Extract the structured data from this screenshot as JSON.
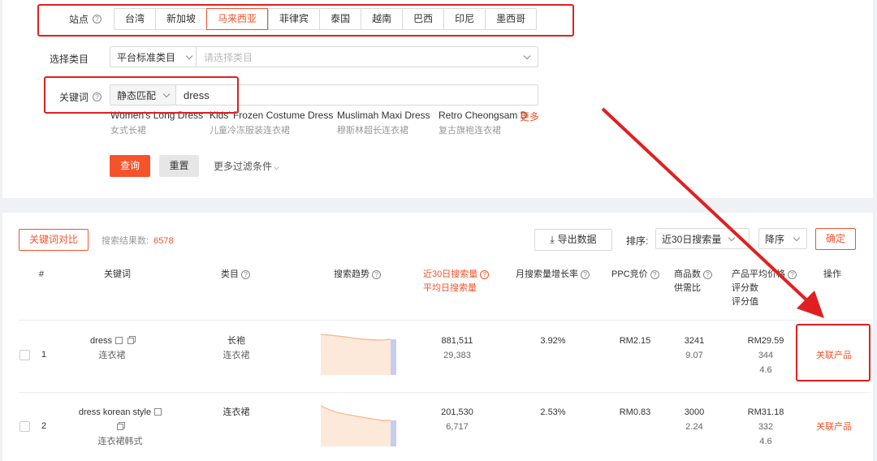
{
  "filter": {
    "site_label": "站点",
    "sites": [
      "台湾",
      "新加坡",
      "马来西亚",
      "菲律宾",
      "泰国",
      "越南",
      "巴西",
      "印尼",
      "墨西哥"
    ],
    "active_site": "马来西亚",
    "category_label": "选择类目",
    "category_type": "平台标准类目",
    "category_placeholder": "请选择类目",
    "keyword_label": "关键词",
    "match_type": "静态匹配",
    "keyword_value": "dress",
    "suggestions": [
      {
        "en": "Women's Long Dress",
        "cn": "女式长裙"
      },
      {
        "en": "Kids' Frozen Costume Dress",
        "cn": "儿童冷冻服装连衣裙"
      },
      {
        "en": "Muslimah Maxi Dress",
        "cn": "穆斯林超长连衣裙"
      },
      {
        "en": "Retro Cheongsam D",
        "cn": "复古旗袍连衣裙"
      }
    ],
    "more_suggestions": "更多",
    "query_button": "查询",
    "reset_button": "重置",
    "more_filters": "更多过滤条件"
  },
  "results": {
    "compare_button": "关键词对比",
    "result_count_label": "搜索结果数:",
    "result_count": "6578",
    "export_button": "导出数据",
    "sort_label": "排序:",
    "sort_field": "近30日搜索量",
    "sort_order": "降序",
    "confirm_button": "确定",
    "columns": {
      "index": "#",
      "keyword": "关键词",
      "category": "类目",
      "trend": "搜索趋势",
      "search30": "近30日搜索量",
      "search_avg": "平均日搜索量",
      "growth": "月搜索量增长率",
      "ppc": "PPC竞价",
      "product_count": "商品数",
      "supply_ratio": "供需比",
      "avg_price": "产品平均价格",
      "rating_count": "评分数",
      "rating_value": "评分值",
      "action": "操作"
    },
    "rows": [
      {
        "index": "1",
        "keyword": "dress",
        "keyword_cn": "连衣裙",
        "category": "长袍",
        "category_sub": "连衣裙",
        "search30": "881,511",
        "search_avg": "29,383",
        "growth": "3.92%",
        "ppc": "RM2.15",
        "product_count": "3241",
        "supply_ratio": "9.07",
        "avg_price": "RM29.59",
        "rating_count": "344",
        "rating_value": "4.6",
        "action": "关联产品"
      },
      {
        "index": "2",
        "keyword": "dress korean style",
        "keyword_cn": "连衣裙韩式",
        "category": "连衣裙",
        "category_sub": "",
        "search30": "201,530",
        "search_avg": "6,717",
        "growth": "2.53%",
        "ppc": "RM0.83",
        "product_count": "3000",
        "supply_ratio": "2.24",
        "avg_price": "RM31.18",
        "rating_count": "332",
        "rating_value": "4.6",
        "action": "关联产品"
      }
    ]
  },
  "colors": {
    "accent": "#f5532a",
    "annotation_red": "#e02020",
    "trend_fill": "#fde9d9",
    "trend_line": "#f6b58a"
  }
}
